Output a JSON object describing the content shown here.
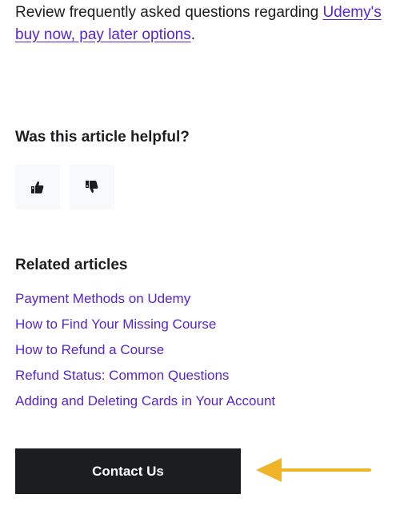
{
  "intro": {
    "text": "Review frequently asked questions regarding ",
    "link_text": "Udemy's buy now, pay later options",
    "suffix": "."
  },
  "feedback": {
    "heading": "Was this article helpful?",
    "thumbs_up_icon": "thumbs-up-icon",
    "thumbs_down_icon": "thumbs-down-icon"
  },
  "related": {
    "heading": "Related articles",
    "articles": [
      "Payment Methods on Udemy",
      "How to Find Your Missing Course",
      "How to Refund a Course",
      "Refund Status: Common Questions",
      "Adding and Deleting Cards in Your Account"
    ]
  },
  "contact": {
    "label": "Contact Us"
  },
  "colors": {
    "link": "#5624d0",
    "text": "#1c1d1f",
    "button_bg": "#1c1d1f",
    "vote_bg": "#f7f9fa",
    "arrow": "#f0b429"
  },
  "annotation": {
    "arrow_icon": "arrow-left-icon"
  }
}
